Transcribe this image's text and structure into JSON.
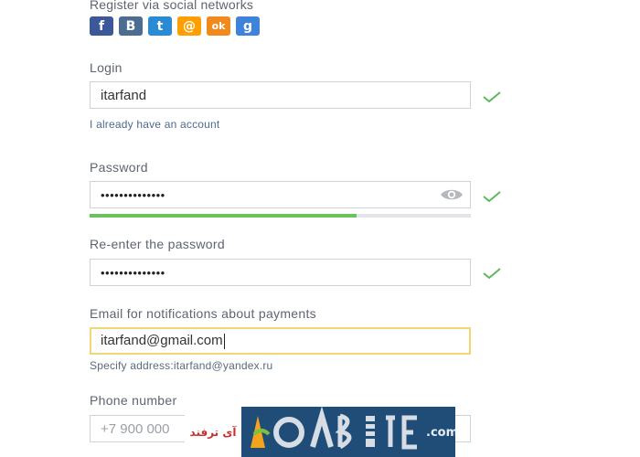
{
  "social": {
    "title": "Register via social networks",
    "networks": [
      {
        "name": "facebook",
        "glyph": "f",
        "color": "#3b5998"
      },
      {
        "name": "vkontakte",
        "glyph": "В",
        "color": "#4c6c91"
      },
      {
        "name": "twitter",
        "glyph": "t",
        "color": "#2a8bd4"
      },
      {
        "name": "mail-ru",
        "glyph": "@",
        "color": "#ff9e00"
      },
      {
        "name": "odnoklassniki",
        "glyph": "ok",
        "color": "#f08a1e"
      },
      {
        "name": "google",
        "glyph": "g",
        "color": "#3f82db"
      }
    ]
  },
  "login": {
    "label": "Login",
    "value": "itarfand",
    "link": "I already have an account"
  },
  "password": {
    "label": "Password",
    "value": "••••••••••••••",
    "strength_fraction": 0.7
  },
  "reenter": {
    "label": "Re-enter the password",
    "value": "••••••••••••••"
  },
  "email": {
    "label": "Email for notifications about payments",
    "value": "itarfand@gmail.com",
    "hint": "Specify address:itarfand@yandex.ru"
  },
  "phone": {
    "label": "Phone number",
    "placeholder": "+7 900 000"
  },
  "watermark": {
    "persian_text": "آی ترفند",
    "domain_text": ".com"
  },
  "colors": {
    "check": "#5cb85c",
    "active_border": "#f1d774",
    "strength": "#6bc25a"
  }
}
